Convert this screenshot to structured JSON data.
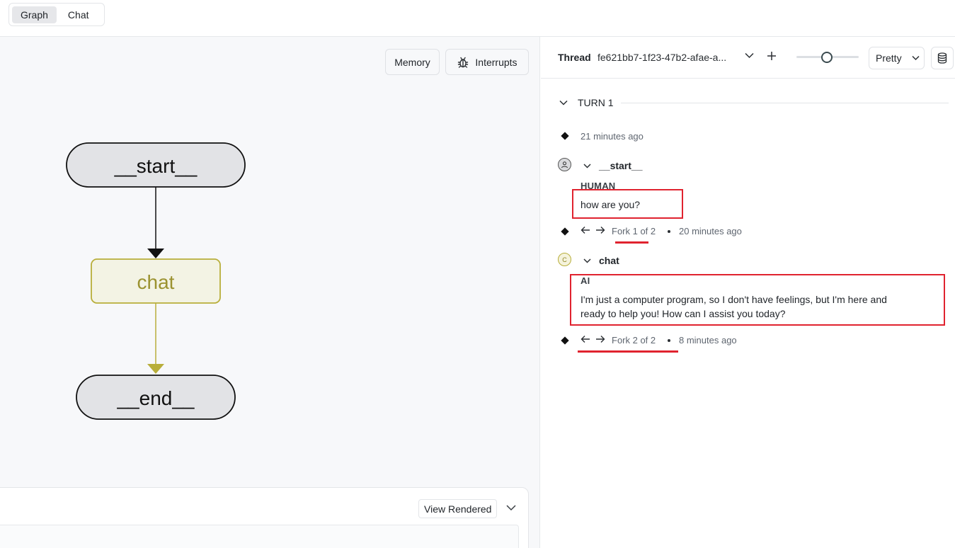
{
  "tabs": [
    {
      "label": "Graph",
      "active": true
    },
    {
      "label": "Chat",
      "active": false
    }
  ],
  "graph_panel": {
    "memory_label": "Memory",
    "interrupts_label": "Interrupts",
    "nodes": {
      "start": "__start__",
      "chat": "chat",
      "end": "__end__"
    },
    "colors": {
      "node_fill": "#e2e3e6",
      "chat_fill": "#f3f3e4",
      "chat_border": "#b8ae3a",
      "chat_text": "#9b9230",
      "chat_edge": "#b8ae3a"
    },
    "view_rendered_label": "View Rendered"
  },
  "thread": {
    "label": "Thread",
    "id": "fe621bb7-1f23-47b2-afae-a...",
    "view_mode": "Pretty",
    "slider_level": 0.5
  },
  "turn": {
    "label": "TURN 1",
    "first_timestamp": "21 minutes ago",
    "steps": [
      {
        "node": "__start__",
        "avatar": "person-icon",
        "role": "HUMAN",
        "message": "how are you?",
        "fork": "Fork 1 of 2",
        "timestamp": "20 minutes ago"
      },
      {
        "node": "chat",
        "avatar_letter": "C",
        "role": "AI",
        "message_line1": "I'm just a computer program, so I don't have feelings, but I'm here and",
        "message_line2": "ready to help you! How can I assist you today?",
        "fork": "Fork 2 of 2",
        "timestamp": "8 minutes ago"
      }
    ]
  },
  "annotation_color": "#e0232f"
}
